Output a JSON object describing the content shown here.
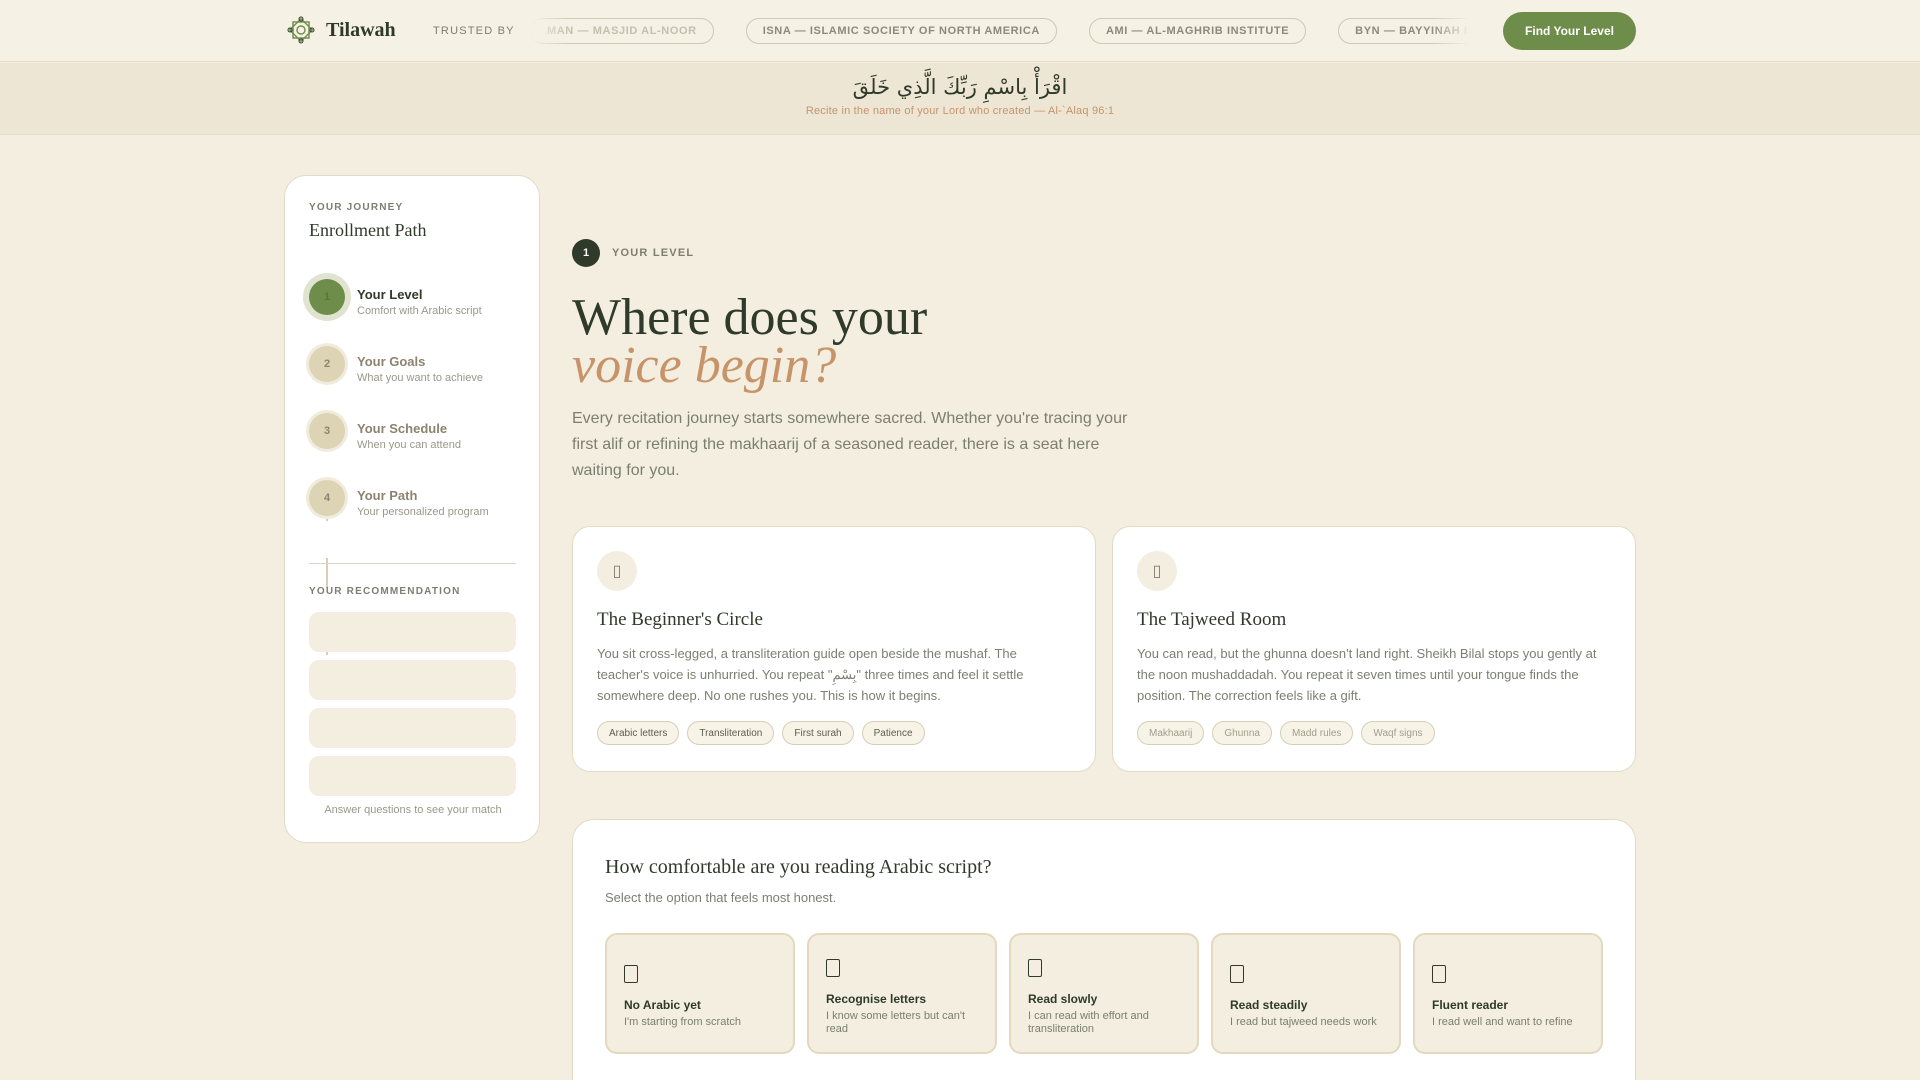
{
  "header": {
    "brand": "Tilawah",
    "trusted_label": "TRUSTED BY",
    "partners": [
      "MAN — MASJID AL-NOOR",
      "ISNA — ISLAMIC SOCIETY OF NORTH AMERICA",
      "AMI — AL-MAGHRIB INSTITUTE",
      "BYN — BAYYINAH INSTITUTE"
    ],
    "cta_label": "Find Your Level"
  },
  "banner": {
    "arabic": "اقْرَأْ بِاسْمِ رَبِّكَ الَّذِي خَلَقَ",
    "translation": "Recite in the name of your Lord who created — Al-`Alaq 96:1"
  },
  "sidebar": {
    "eyebrow": "YOUR JOURNEY",
    "title": "Enrollment Path",
    "steps": [
      {
        "number": "1",
        "title": "Your Level",
        "subtitle": "Comfort with Arabic script"
      },
      {
        "number": "2",
        "title": "Your Goals",
        "subtitle": "What you want to achieve"
      },
      {
        "number": "3",
        "title": "Your Schedule",
        "subtitle": "When you can attend"
      },
      {
        "number": "4",
        "title": "Your Path",
        "subtitle": "Your personalized program"
      }
    ],
    "recommendation_label": "YOUR RECOMMENDATION",
    "footer": "Answer questions to see your match"
  },
  "main": {
    "step_number": "1",
    "step_label": "YOUR LEVEL",
    "headline_line1": "Where does your",
    "headline_line2": "voice begin?",
    "intro": "Every recitation journey starts somewhere sacred. Whether you're tracing your first alif or refining the makhaarij of a seasoned reader, there is a seat here waiting for you.",
    "cards": [
      {
        "title": "The Beginner's Circle",
        "body": "You sit cross-legged, a transliteration guide open beside the mushaf. The teacher's voice is unhurried. You repeat \"بِسْمِ\" three times and feel it settle somewhere deep. No one rushes you. This is how it begins.",
        "tags": [
          "Arabic letters",
          "Transliteration",
          "First surah",
          "Patience"
        ]
      },
      {
        "title": "The Tajweed Room",
        "body": "You can read, but the ghunna doesn't land right. Sheikh Bilal stops you gently at the noon mushaddadah. You repeat it seven times until your tongue finds the position. The correction feels like a gift.",
        "tags": [
          "Makhaarij",
          "Ghunna",
          "Madd rules",
          "Waqf signs"
        ]
      }
    ]
  },
  "quiz": {
    "question": "How comfortable are you reading Arabic script?",
    "hint": "Select the option that feels most honest.",
    "options": [
      {
        "title": "No Arabic yet",
        "description": "I'm starting from scratch"
      },
      {
        "title": "Recognise letters",
        "description": "I know some letters but can't read"
      },
      {
        "title": "Read slowly",
        "description": "I can read with effort and transliteration"
      },
      {
        "title": "Read steadily",
        "description": "I read but tajweed needs work"
      },
      {
        "title": "Fluent reader",
        "description": "I read well and want to refine"
      }
    ]
  },
  "colors": {
    "background": "#f3eedf",
    "primary_green": "#6e8c4a",
    "dark_green": "#2f3a2a",
    "accent_terracotta": "#c7946a"
  },
  "icons": {
    "logo": "geometric-star-icon",
    "card": "placeholder-glyph-icon",
    "option": "placeholder-glyph-icon"
  }
}
